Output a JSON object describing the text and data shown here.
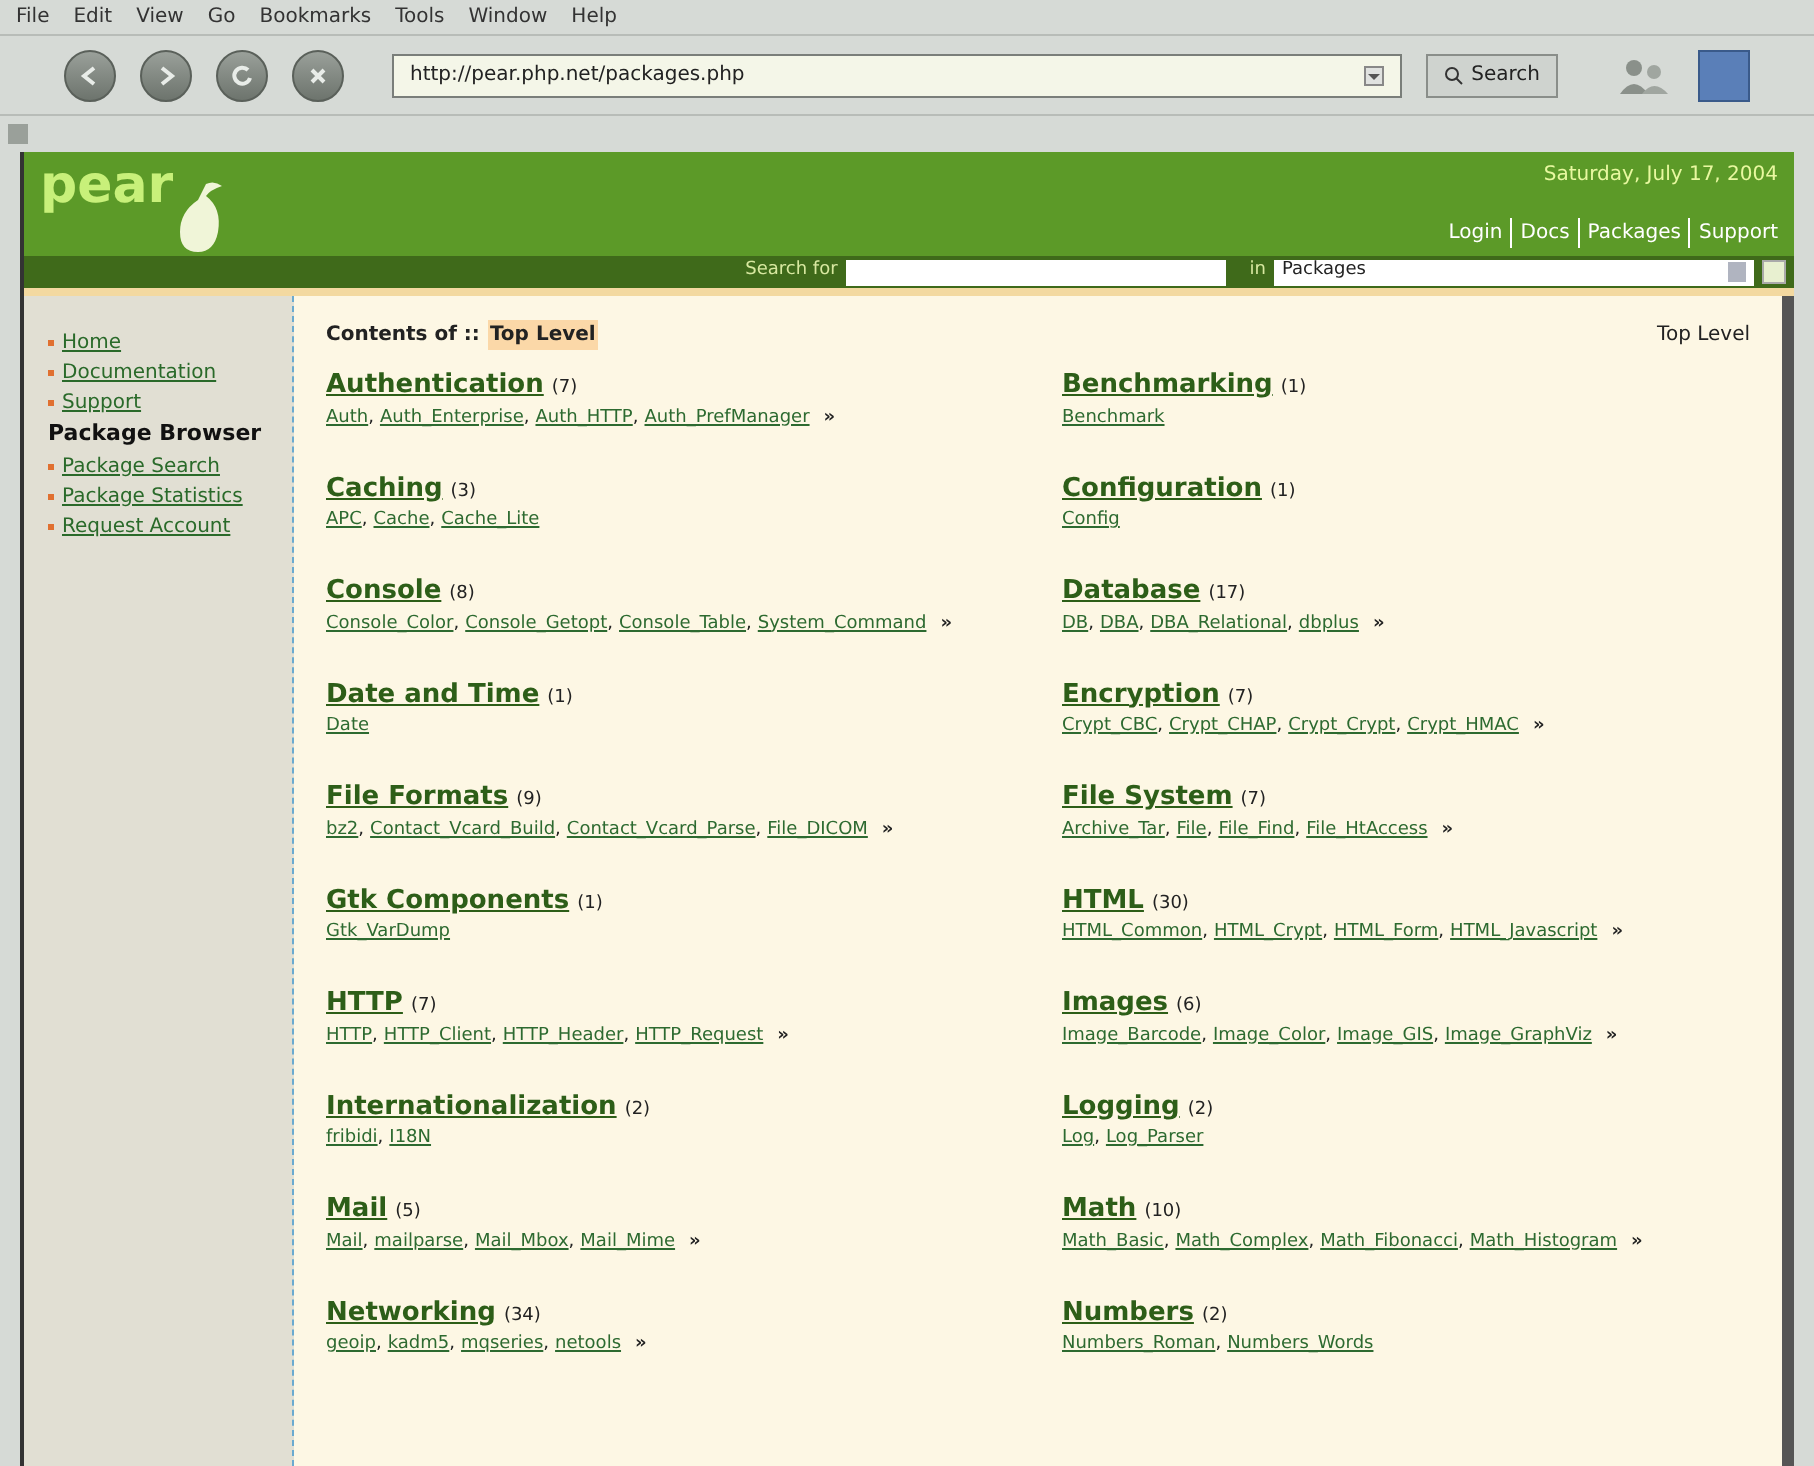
{
  "browser": {
    "menu": [
      "File",
      "Edit",
      "View",
      "Go",
      "Bookmarks",
      "Tools",
      "Window",
      "Help"
    ],
    "address": "http://pear.php.net/packages.php",
    "search_button": "Search"
  },
  "header": {
    "logo": "pear",
    "date": "Saturday, July 17, 2004",
    "links": [
      "Login",
      "Docs",
      "Packages",
      "Support"
    ],
    "search_label": "Search for",
    "search_in_label": "in",
    "search_scope": "Packages"
  },
  "sidebar": [
    {
      "kind": "link",
      "label": "Home"
    },
    {
      "kind": "link",
      "label": "Documentation"
    },
    {
      "kind": "link",
      "label": "Support"
    },
    {
      "kind": "heading",
      "label": "Package Browser"
    },
    {
      "kind": "link",
      "label": "Package Search"
    },
    {
      "kind": "link",
      "label": "Package Statistics"
    },
    {
      "kind": "link",
      "label": "Request Account"
    }
  ],
  "package_separator": ",",
  "breadcrumb": {
    "label": "Contents of ::",
    "current": "Top Level",
    "right": "Top Level"
  },
  "categories": [
    {
      "name": "Authentication",
      "count": "(7)",
      "packages": [
        "Auth",
        "Auth_Enterprise",
        "Auth_HTTP",
        "Auth_PrefManager"
      ],
      "more": "»"
    },
    {
      "name": "Benchmarking",
      "count": "(1)",
      "packages": [
        "Benchmark"
      ]
    },
    {
      "name": "Caching",
      "count": "(3)",
      "packages": [
        "APC",
        "Cache",
        "Cache_Lite"
      ]
    },
    {
      "name": "Configuration",
      "count": "(1)",
      "packages": [
        "Config"
      ]
    },
    {
      "name": "Console",
      "count": "(8)",
      "packages": [
        "Console_Color",
        "Console_Getopt",
        "Console_Table",
        "System_Command"
      ],
      "more": "»"
    },
    {
      "name": "Database",
      "count": "(17)",
      "packages": [
        "DB",
        "DBA",
        "DBA_Relational",
        "dbplus"
      ],
      "more": "»"
    },
    {
      "name": "Date and Time",
      "count": "(1)",
      "packages": [
        "Date"
      ]
    },
    {
      "name": "Encryption",
      "count": "(7)",
      "packages": [
        "Crypt_CBC",
        "Crypt_CHAP",
        "Crypt_Crypt",
        "Crypt_HMAC"
      ],
      "more": "»"
    },
    {
      "name": "File Formats",
      "count": "(9)",
      "packages": [
        "bz2",
        "Contact_Vcard_Build",
        "Contact_Vcard_Parse",
        "File_DICOM"
      ],
      "more": "»"
    },
    {
      "name": "File System",
      "count": "(7)",
      "packages": [
        "Archive_Tar",
        "File",
        "File_Find",
        "File_HtAccess"
      ],
      "more": "»"
    },
    {
      "name": "Gtk Components",
      "count": "(1)",
      "packages": [
        "Gtk_VarDump"
      ]
    },
    {
      "name": "HTML",
      "count": "(30)",
      "packages": [
        "HTML_Common",
        "HTML_Crypt",
        "HTML_Form",
        "HTML_Javascript"
      ],
      "more": "»"
    },
    {
      "name": "HTTP",
      "count": "(7)",
      "packages": [
        "HTTP",
        "HTTP_Client",
        "HTTP_Header",
        "HTTP_Request"
      ],
      "more": "»"
    },
    {
      "name": "Images",
      "count": "(6)",
      "packages": [
        "Image_Barcode",
        "Image_Color",
        "Image_GIS",
        "Image_GraphViz"
      ],
      "more": "»"
    },
    {
      "name": "Internationalization",
      "count": "(2)",
      "packages": [
        "fribidi",
        "I18N"
      ]
    },
    {
      "name": "Logging",
      "count": "(2)",
      "packages": [
        "Log",
        "Log_Parser"
      ]
    },
    {
      "name": "Mail",
      "count": "(5)",
      "packages": [
        "Mail",
        "mailparse",
        "Mail_Mbox",
        "Mail_Mime"
      ],
      "more": "»"
    },
    {
      "name": "Math",
      "count": "(10)",
      "packages": [
        "Math_Basic",
        "Math_Complex",
        "Math_Fibonacci",
        "Math_Histogram"
      ],
      "more": "»"
    },
    {
      "name": "Networking",
      "count": "(34)",
      "packages": [
        "geoip",
        "kadm5",
        "mqseries",
        "netools"
      ],
      "more": "»"
    },
    {
      "name": "Numbers",
      "count": "(2)",
      "packages": [
        "Numbers_Roman",
        "Numbers_Words"
      ]
    }
  ]
}
